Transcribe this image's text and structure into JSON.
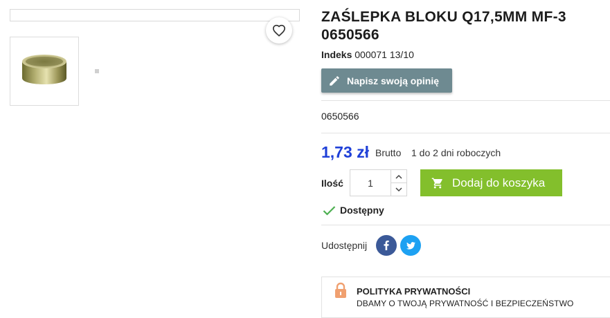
{
  "product": {
    "title": "ZAŚLEPKA BLOKU Q17,5MM MF-3 0650566",
    "index_label": "Indeks",
    "index_value": "000071 13/10",
    "review_button": "Napisz swoją opinię",
    "reference": "0650566",
    "price": "1,73 zł",
    "price_type": "Brutto",
    "delivery": "1 do 2 dni roboczych",
    "quantity_label": "Ilość",
    "quantity_value": "1",
    "add_to_cart": "Dodaj do koszyka",
    "availability": "Dostępny"
  },
  "share": {
    "label": "Udostępnij",
    "networks": [
      "facebook-icon",
      "twitter-icon"
    ]
  },
  "policy": {
    "title": "POLITYKA PRYWATNOŚCI",
    "text": "DBAMY O TWOJĄ PRYWATNOŚĆ I BEZPIECZEŃSTWO"
  },
  "gallery": {
    "wishlist_icon": "heart-icon",
    "thumbnail_icon": "blanking-plug-image"
  },
  "colors": {
    "price": "#1f40d8",
    "review_button": "#6e8a91",
    "cart_button": "#83bf2c",
    "available_check": "#4caf50",
    "facebook": "#3b5998",
    "twitter": "#1da1f2",
    "policy_icon": "#f0a070"
  }
}
